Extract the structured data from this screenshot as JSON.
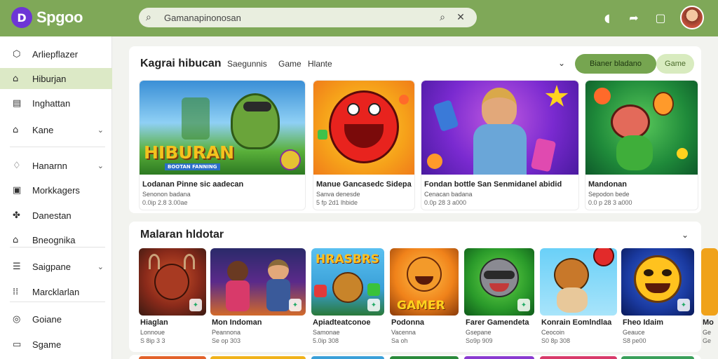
{
  "app": {
    "logo_mark": "D",
    "name": "Spgoo"
  },
  "search": {
    "value": "Gamanapinonosan"
  },
  "sidebar": {
    "items": [
      {
        "label": "Arliepflazer",
        "icon": "hexagon-icon",
        "glyph": "⬡"
      },
      {
        "label": "Hiburjan",
        "icon": "home-icon",
        "glyph": "⌂",
        "active": true
      },
      {
        "label": "Inghattan",
        "icon": "document-icon",
        "glyph": "▤"
      },
      {
        "label": "Kane",
        "icon": "home-icon",
        "glyph": "⌂",
        "chevron": true
      },
      {
        "label": "Hanarnn",
        "icon": "bell-icon",
        "glyph": "♢",
        "chevron": true
      },
      {
        "label": "Morkkagers",
        "icon": "image-icon",
        "glyph": "▣"
      },
      {
        "label": "Danestan",
        "icon": "puzzle-icon",
        "glyph": "✤"
      },
      {
        "label": "Bneognika",
        "icon": "bag-icon",
        "glyph": "⌂"
      },
      {
        "label": "Saigpane",
        "icon": "list-icon",
        "glyph": "☰",
        "chevron": true
      },
      {
        "label": "Marcklarlan",
        "icon": "grid-icon",
        "glyph": "⁞⁞"
      },
      {
        "label": "Goiane",
        "icon": "target-icon",
        "glyph": "◎"
      },
      {
        "label": "Sgame",
        "icon": "card-icon",
        "glyph": "▭"
      }
    ]
  },
  "featured": {
    "title": "Kagrai hibucan",
    "tabs": [
      "Saegunnis",
      "Game",
      "Hlante"
    ],
    "primary_button": "Bianer bladano",
    "secondary_button": "Game",
    "cards": [
      {
        "title": "Lodanan Pinne sic aadecan",
        "sub1": "Senonon badana",
        "sub2": "0.0ip 2.8 3.00ae",
        "art": "HIBURAN",
        "art_sub": "BOOTAN FANNING"
      },
      {
        "title": "Manue Gancasedc Sidepa",
        "sub1": "Sanva denesde",
        "sub2": "5 fp 2d1 lhbide",
        "art": "",
        "art_sub": ""
      },
      {
        "title": "Fondan bottle San Senmidanel abidid",
        "sub1": "Cenacan badana",
        "sub2": "0.0p 28 3 a000",
        "art": "",
        "art_sub": ""
      },
      {
        "title": "Mandonan",
        "sub1": "Sepodon bede",
        "sub2": "0.0 p 28 3 a000",
        "art": "",
        "art_sub": ""
      }
    ]
  },
  "section2": {
    "title": "Malaran hldotar",
    "tiles": [
      {
        "title": "Hiaglan",
        "sub1": "Lonnoue",
        "sub2": "S 8ip 3 3",
        "art": ""
      },
      {
        "title": "Mon Indoman",
        "sub1": "Peannona",
        "sub2": "Se op 303",
        "art": ""
      },
      {
        "title": "Apiadteatconoe",
        "sub1": "Samonae",
        "sub2": "5.0ip 308",
        "art": "HRASBRS"
      },
      {
        "title": "Podonna",
        "sub1": "Vacenna",
        "sub2": "Sa oh",
        "art": "GAMER"
      },
      {
        "title": "Farer Gamendeta",
        "sub1": "Gsepane",
        "sub2": "So9p 909",
        "art": ""
      },
      {
        "title": "Konrain Eomlndlaa",
        "sub1": "Ceocoin",
        "sub2": "S0 8p 308",
        "art": ""
      },
      {
        "title": "Fheo Idaim",
        "sub1": "Geauce",
        "sub2": "S8 pe00",
        "art": ""
      },
      {
        "title": "Mo",
        "sub1": "Ge",
        "sub2": "Ge",
        "art": ""
      }
    ]
  },
  "colors": {
    "topbar": "#7fa858",
    "accent": "#76a550",
    "active_nav": "#dce9c6"
  }
}
